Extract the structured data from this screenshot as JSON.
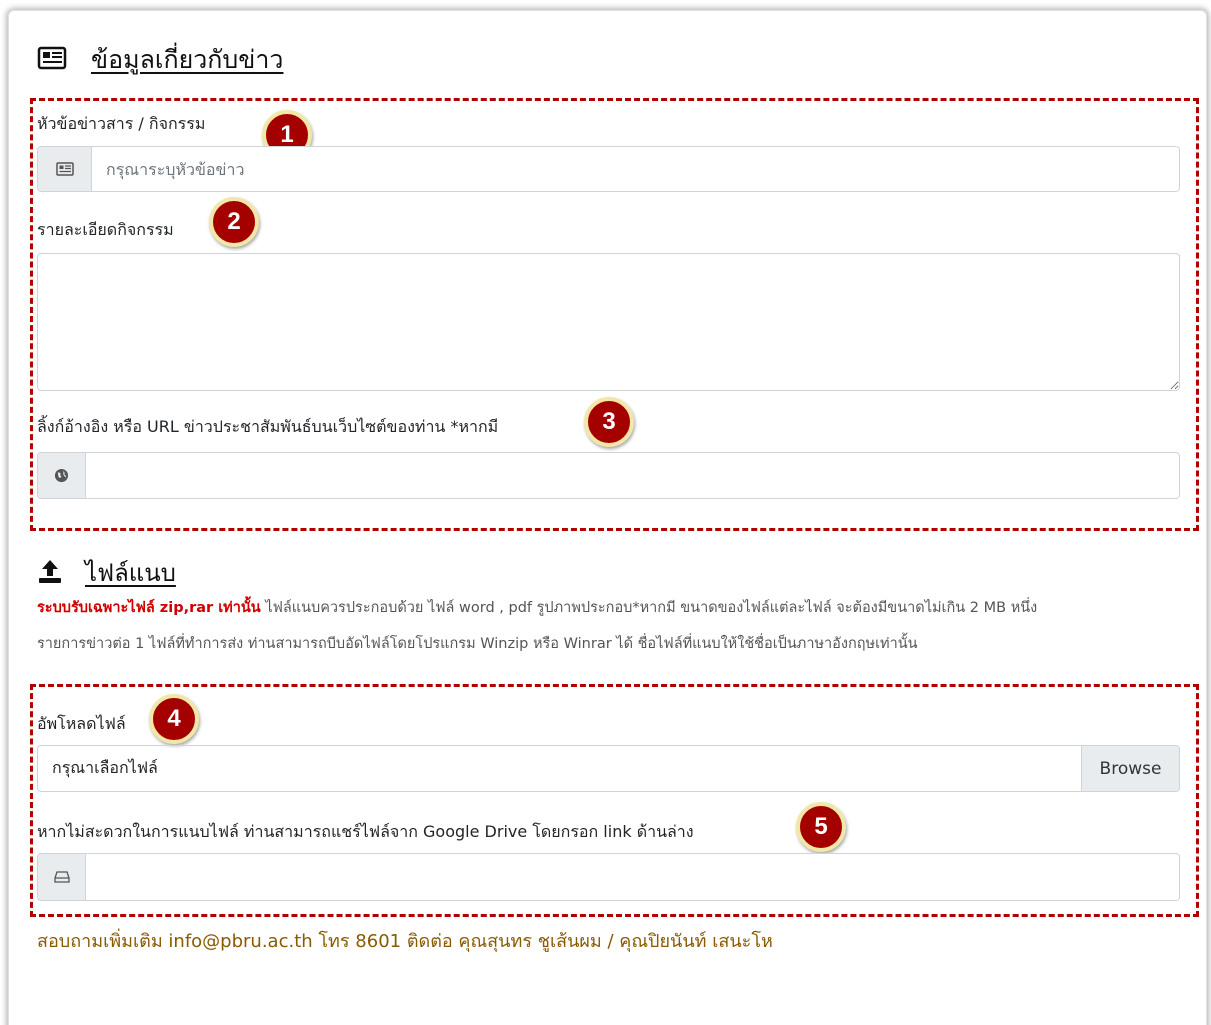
{
  "news_section": {
    "title": "ข้อมูลเกี่ยวกับข่าว",
    "icon": "newspaper-icon"
  },
  "fields": {
    "headline": {
      "label": "หัวข้อข่าวสาร / กิจกรรม",
      "placeholder": "กรุณาระบุหัวข้อข่าว",
      "value": "",
      "icon": "newspaper-icon"
    },
    "details": {
      "label": "รายละเอียดกิจกรรม",
      "value": ""
    },
    "reference_link": {
      "label": "ลิ้งก์อ้างอิง หรือ URL ข่าวประชาสัมพันธ์บนเว็บไซต์ของท่าน *หากมี",
      "value": "",
      "icon": "globe-icon"
    }
  },
  "attachment_section": {
    "title": "ไฟล์แนบ",
    "icon": "upload-icon",
    "warning": "ระบบรับเฉพาะไฟล์ zip,rar เท่านั้น",
    "note_line1": "ไฟล์แนบควรประกอบด้วย ไฟล์ word , pdf รูปภาพประกอบ*หากมี ขนาดของไฟล์แต่ละไฟล์ จะต้องมีขนาดไม่เกิน 2 MB หนึ่ง",
    "note_line2": "รายการข่าวต่อ 1 ไฟล์ที่ทำการส่ง ท่านสามารถบีบอัดไฟล์โดยโปรแกรม Winzip หรือ Winrar ได้ ชื่อไฟล์ที่แนบให้ใช้ชื่อเป็นภาษาอังกฤษเท่านั้น"
  },
  "upload": {
    "label": "อัพโหลดไฟล์",
    "file_placeholder": "กรุณาเลือกไฟล์",
    "browse_label": "Browse",
    "drive_label": "หากไม่สะดวกในการแนบไฟล์ ท่านสามารถแชร์ไฟล์จาก Google Drive โดยกรอก link ด้านล่าง",
    "drive_value": "",
    "drive_icon": "hard-drive-icon"
  },
  "badges": [
    "1",
    "2",
    "3",
    "4",
    "5"
  ],
  "contact": "สอบถามเพิ่มเติม info@pbru.ac.th โทร 8601 ติดต่อ คุณสุนทร ชูเส้นผม / คุณปิยนันท์ เสนะโห",
  "colors": {
    "badge_fill": "#a50000",
    "badge_ring": "#f2e6a8",
    "dashed_border": "#b00000",
    "warning_text": "#d00000",
    "contact_text": "#8a5a00"
  }
}
